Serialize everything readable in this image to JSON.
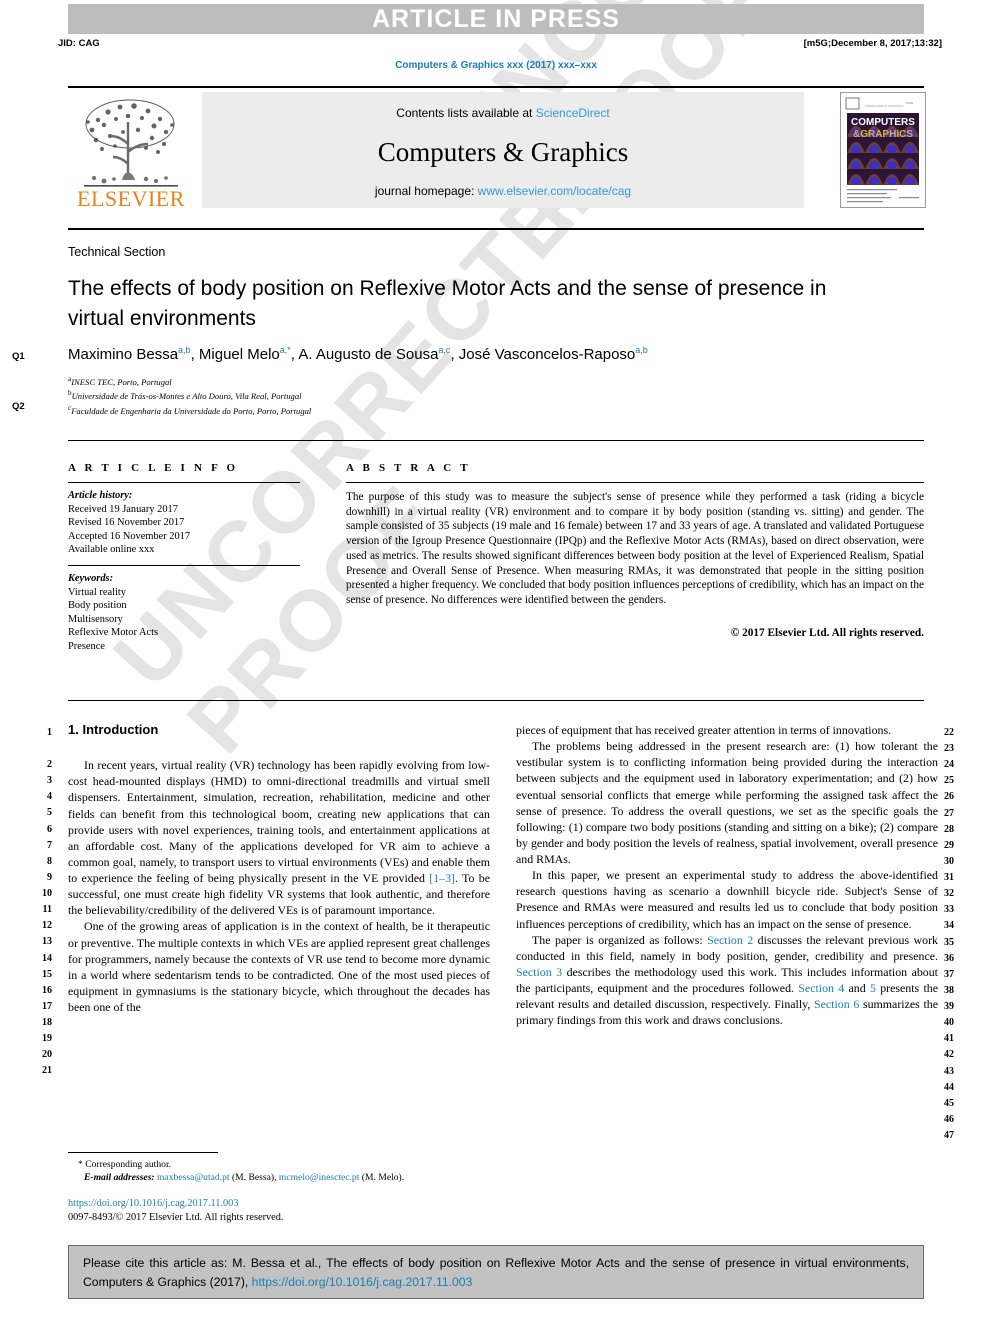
{
  "watermark": {
    "line1": "UNCORRECTED PROOF"
  },
  "header": {
    "article_in_press": "ARTICLE IN PRESS",
    "jid": "JID: CAG",
    "build_stamp": "[m5G;December 8, 2017;13:32]",
    "journal_ref": "Computers & Graphics xxx (2017) xxx–xxx"
  },
  "masthead": {
    "contents_prefix": "Contents lists available at ",
    "sciencedirect": "ScienceDirect",
    "journal_title": "Computers & Graphics",
    "homepage_prefix": "journal homepage: ",
    "homepage_url": "www.elsevier.com/locate/cag",
    "publisher_logo_text": "ELSEVIER",
    "cover_title_line1": "COMPUTERS",
    "cover_title_line2": "&GRAPHICS"
  },
  "article": {
    "section_label": "Technical Section",
    "title": "The effects of body position on Reflexive Motor Acts and the sense of presence in virtual environments",
    "authors": [
      {
        "name": "Maximino Bessa",
        "sup": "a,b",
        "sep": ", "
      },
      {
        "name": "Miguel Melo",
        "sup": "a,*",
        "sep": ", "
      },
      {
        "name": "A. Augusto de Sousa",
        "sup": "a,c",
        "sep": ", "
      },
      {
        "name": "José Vasconcelos-Raposo",
        "sup": "a,b",
        "sep": ""
      }
    ],
    "affiliations": [
      {
        "marker": "a",
        "text": "INESC TEC, Porto, Portugal"
      },
      {
        "marker": "b",
        "text": "Universidade de Trás-os-Montes e Alto Douro, Vila Real, Portugal"
      },
      {
        "marker": "c",
        "text": "Faculdade de Engenharia da Universidade do Porto, Porto, Portugal"
      }
    ],
    "query_markers": {
      "q1": "Q1",
      "q2": "Q2"
    }
  },
  "article_info": {
    "heading": "A R T I C L E    I N F O",
    "history_label": "Article history:",
    "history": [
      "Received 19 January 2017",
      "Revised 16 November 2017",
      "Accepted 16 November 2017",
      "Available online xxx"
    ],
    "keywords_label": "Keywords:",
    "keywords": [
      "Virtual reality",
      "Body position",
      "Multisensory",
      "Reflexive Motor Acts",
      "Presence"
    ]
  },
  "abstract": {
    "heading": "A B S T R A C T",
    "text": "The purpose of this study was to measure the subject's sense of presence while they performed a task (riding a bicycle downhill) in a virtual reality (VR) environment and to compare it by body position (standing vs. sitting) and gender. The sample consisted of 35 subjects (19 male and 16 female) between 17 and 33 years of age. A translated and validated Portuguese version of the Igroup Presence Questionnaire (IPQp) and the Reflexive Motor Acts (RMAs), based on direct observation, were used as metrics. The results showed significant differences between body position at the level of Experienced Realism, Spatial Presence and Overall Sense of Presence. When measuring RMAs, it was demonstrated that people in the sitting position presented a higher frequency. We concluded that body position influences perceptions of credibility, which has an impact on the sense of presence. No differences were identified between the genders.",
    "copyright": "© 2017 Elsevier Ltd. All rights reserved."
  },
  "body": {
    "intro_heading": "1. Introduction",
    "left_paragraphs": [
      "In recent years, virtual reality (VR) technology has been rapidly evolving from low-cost head-mounted displays (HMD) to omni-directional treadmills and virtual smell dispensers. Entertainment, simulation, recreation, rehabilitation, medicine and other fields can benefit from this technological boom, creating new applications that can provide users with novel experiences, training tools, and entertainment applications at an affordable cost. Many of the applications developed for VR aim to achieve a common goal, namely, to transport users to virtual environments (VEs) and enable them to experience the feeling of being physically present in the VE provided [1–3]. To be successful, one must create high fidelity VR systems that look authentic, and therefore the believability/credibility of the delivered VEs is of paramount importance.",
      "One of the growing areas of application is in the context of health, be it therapeutic or preventive. The multiple contexts in which VEs are applied represent great challenges for programmers, namely because the contexts of VR use tend to become more dynamic in a world where sedentarism tends to be contradicted. One of the most used pieces of equipment in gymnasiums is the stationary bicycle, which throughout the decades has been one of the"
    ],
    "right_paragraphs": [
      "pieces of equipment that has received greater attention in terms of innovations.",
      "The problems being addressed in the present research are: (1)  how tolerant the vestibular system is to conflicting information being provided during the interaction between subjects and the equipment used in laboratory experimentation; and (2)  how eventual sensorial conflicts that emerge while performing the assigned task affect the sense of presence. To address the overall questions, we set as the specific goals the following: (1)  compare two body positions (standing and sitting on a bike); (2)  compare by gender and body position the levels of realness, spatial involvement, overall presence and RMAs.",
      "In this paper, we present an experimental study to address the above-identified research questions having as scenario a downhill bicycle ride. Subject's Sense of Presence and RMAs were measured and results led us to conclude that body position influences perceptions of credibility, which has an impact on the sense of presence.",
      "The paper is organized as follows: Section 2 discusses the relevant previous work conducted in this field, namely in body position, gender, credibility and presence. Section 3 describes the methodology used this work. This includes information about the participants, equipment and the procedures followed. Section 4 and 5 presents the relevant results and detailed discussion, respectively. Finally, Section 6 summarizes the primary findings from this work and draws conclusions."
    ],
    "left_line_numbers": [
      "1",
      "2",
      "3",
      "4",
      "5",
      "6",
      "7",
      "8",
      "9",
      "10",
      "11",
      "12",
      "13",
      "14",
      "15",
      "16",
      "17",
      "18",
      "19",
      "20",
      "21"
    ],
    "right_line_numbers": [
      "22",
      "23",
      "24",
      "25",
      "26",
      "27",
      "28",
      "29",
      "30",
      "31",
      "32",
      "33",
      "34",
      "35",
      "36",
      "37",
      "38",
      "39",
      "40",
      "41",
      "42",
      "43",
      "44",
      "45",
      "46",
      "47"
    ],
    "inline_links": [
      "[1–3]",
      "Section 2",
      "Section 3",
      "Section 4",
      "5",
      "Section 6"
    ]
  },
  "footnote": {
    "corresponding_marker": "*",
    "corresponding_text": "Corresponding author.",
    "email_label": "E-mail addresses:",
    "emails": [
      {
        "address": "maxbessa@utad.pt",
        "owner": "(M. Bessa)"
      },
      {
        "address": "mcmelo@inesctec.pt",
        "owner": "(M. Melo)."
      }
    ],
    "doi": "https://doi.org/10.1016/j.cag.2017.11.003",
    "issn_line": "0097-8493/© 2017 Elsevier Ltd. All rights reserved."
  },
  "citation_footer": {
    "text_before_link": "Please cite this article as: M. Bessa et al., The effects of body position on Reflexive Motor Acts and the sense of presence in virtual environments, Computers & Graphics (2017), ",
    "link": "https://doi.org/10.1016/j.cag.2017.11.003"
  },
  "colors": {
    "link_blue": "#1a7eb5",
    "band_gray": "#bdbdbd",
    "mast_gray": "#ececec",
    "footer_gray": "#c2c2c2",
    "elsevier_orange": "#e8821a"
  }
}
